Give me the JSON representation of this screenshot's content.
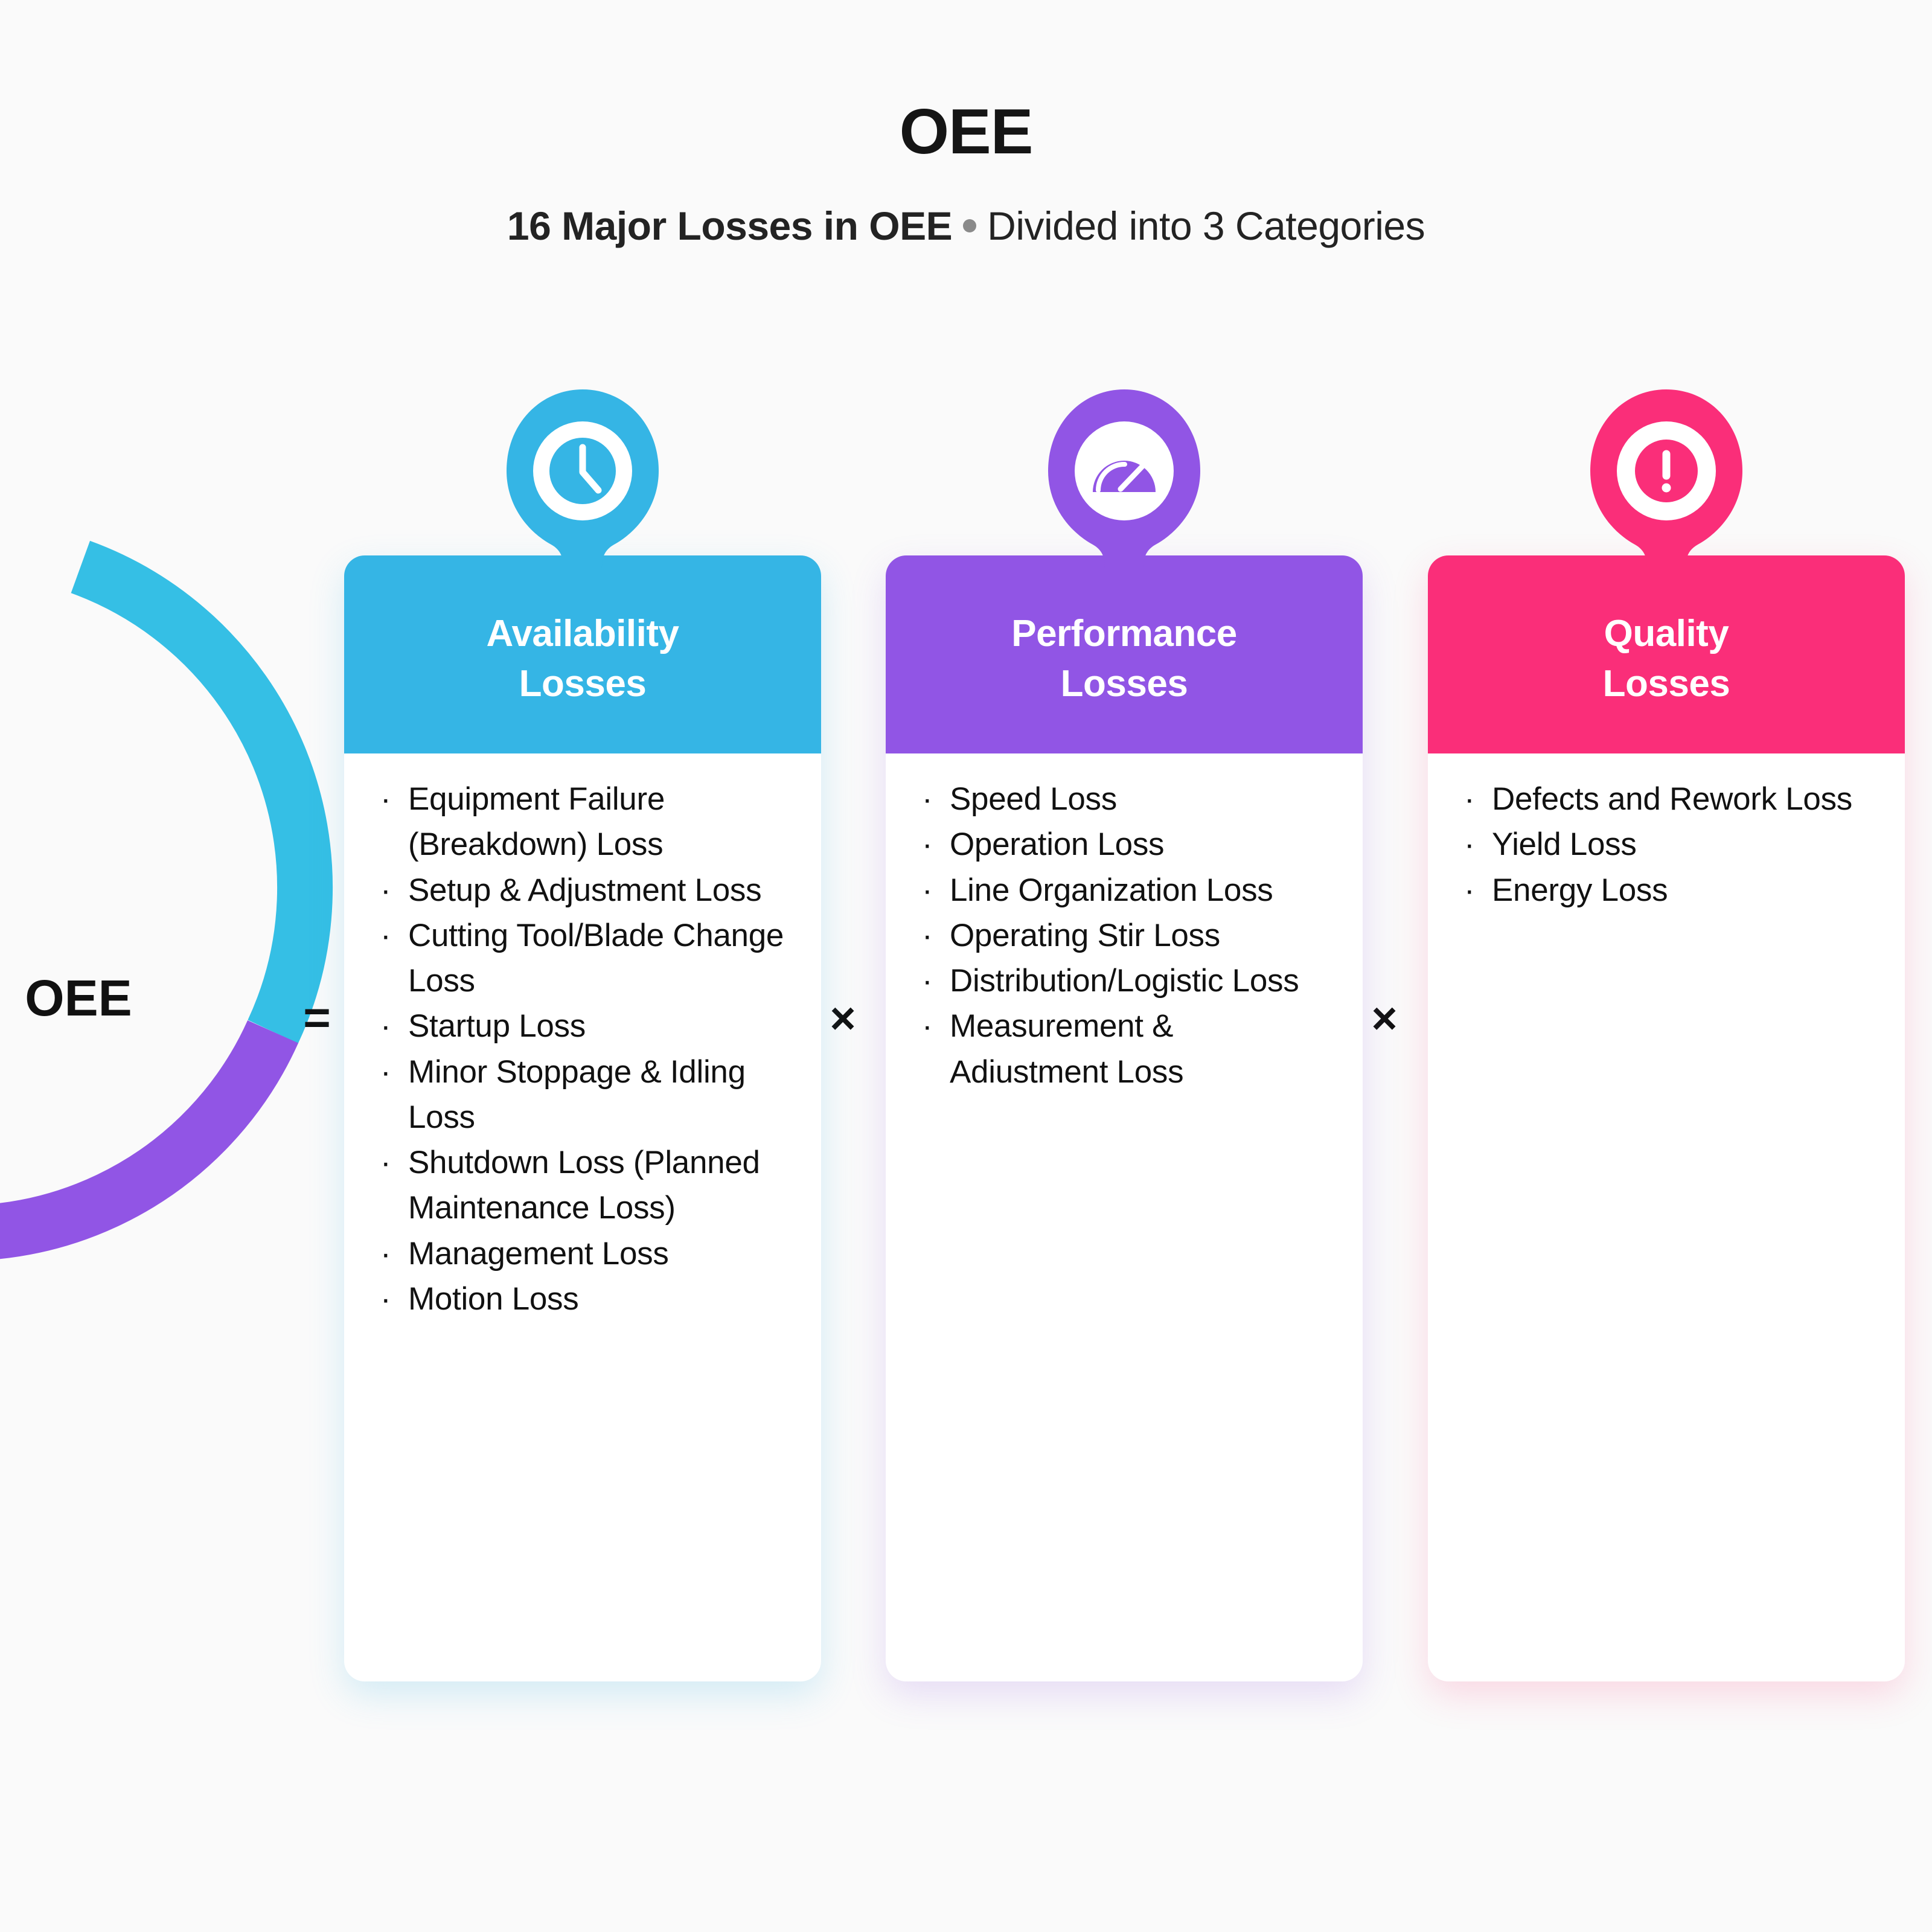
{
  "header": {
    "title": "OEE",
    "subtitle_strong": "16 Major Losses in OEE",
    "subtitle_rest": "Divided into 3 Categories",
    "bullet_separator_icon": "dot-separator-icon"
  },
  "formula": {
    "donut_center_label": "OEE",
    "equals_symbol": "=",
    "multiply_symbol_1": "×",
    "multiply_symbol_2": "×"
  },
  "colors": {
    "availability": "#35B5E5",
    "performance": "#9155E5",
    "quality": "#FA2E79",
    "background": "#FAFAFA",
    "text": "#111111",
    "card": "#FFFFFF"
  },
  "chart_data": {
    "type": "pie",
    "title": "OEE",
    "subtype": "donut",
    "center_label": "OEE",
    "legend": "none",
    "categories": [
      "Availability Losses",
      "Performance Losses",
      "Quality Losses"
    ],
    "colors": [
      "#35B5E5",
      "#9155E5",
      "#FA2E79"
    ],
    "segments": [
      {
        "name": "Availability Losses",
        "color": "#35B5E5",
        "start_angle_deg": -70,
        "end_angle_deg": 25
      },
      {
        "name": "Performance Losses",
        "color": "#9155E5",
        "start_angle_deg": 25,
        "end_angle_deg": 105
      },
      {
        "name": "Quality Losses",
        "color": "#FA2E79",
        "start_angle_deg": 105,
        "end_angle_deg": 170
      }
    ]
  },
  "columns": [
    {
      "id": "availability",
      "icon": "clock-icon",
      "title_line1": "Availability",
      "title_line2": "Losses",
      "accent": "#35B5E5",
      "items": [
        "Equipment Failure (Breakdown) Loss",
        "Setup & Adjustment Loss",
        "Cutting Tool/Blade Change Loss",
        "Startup Loss",
        "Minor Stoppage & Idling Loss",
        "Shutdown Loss (Planned Maintenance Loss)",
        "Management Loss",
        "Motion Loss"
      ]
    },
    {
      "id": "performance",
      "icon": "speedometer-icon",
      "title_line1": "Performance",
      "title_line2": "Losses",
      "accent": "#9155E5",
      "items": [
        "Speed Loss",
        "Operation Loss",
        "Line Organization Loss",
        "Operating Stir Loss",
        "Distribution/Logistic Loss",
        "Measurement & Adiustment Loss"
      ]
    },
    {
      "id": "quality",
      "icon": "alert-exclamation-icon",
      "title_line1": "Quality",
      "title_line2": "Losses",
      "accent": "#FA2E79",
      "items": [
        "Defects and Rework Loss",
        "Yield Loss",
        "Energy Loss"
      ]
    }
  ],
  "bullet_glyph": "·"
}
